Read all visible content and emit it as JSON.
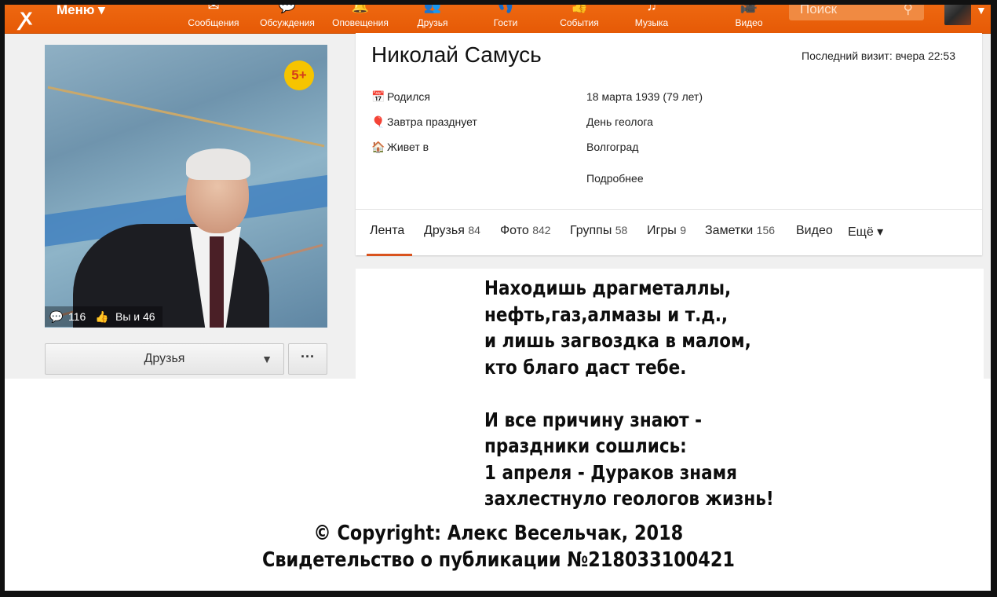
{
  "topbar": {
    "logo": "ок",
    "menu_label": "Меню ▾",
    "nav": [
      {
        "label": "Сообщения",
        "icon": "messages-icon",
        "glyph": "✉"
      },
      {
        "label": "Обсуждения",
        "icon": "discussions-icon",
        "glyph": "💬"
      },
      {
        "label": "Оповещения",
        "icon": "bell-icon",
        "glyph": "🔔"
      },
      {
        "label": "Друзья",
        "icon": "friends-icon",
        "glyph": "👥"
      },
      {
        "label": "Гости",
        "icon": "guests-icon",
        "glyph": "👣"
      },
      {
        "label": "События",
        "icon": "events-icon",
        "glyph": "👍"
      },
      {
        "label": "Музыка",
        "icon": "music-icon",
        "glyph": "♫"
      },
      {
        "label": "Видео",
        "icon": "video-icon",
        "glyph": "🎥"
      }
    ],
    "search_placeholder": "Поиск",
    "accent": "#ee6512"
  },
  "profile": {
    "name": "Николай Самусь",
    "last_visit": "Последний визит: вчера 22:53",
    "badge": "5+",
    "comments_count": "116",
    "likes_text": "Вы и 46",
    "info": [
      {
        "label": "Родился",
        "value": "18 марта 1939 (79 лет)",
        "icon": "calendar-icon"
      },
      {
        "label": "Завтра празднует",
        "value": "День геолога",
        "icon": "balloons-icon"
      },
      {
        "label": "Живет в",
        "value": "Волгоград",
        "icon": "house-icon"
      }
    ],
    "more_link": "Подробнее",
    "friends_button": "Друзья",
    "more_button": "···",
    "tabs": [
      {
        "label": "Лента",
        "count": ""
      },
      {
        "label": "Друзья",
        "count": "84"
      },
      {
        "label": "Фото",
        "count": "842"
      },
      {
        "label": "Группы",
        "count": "58"
      },
      {
        "label": "Игры",
        "count": "9"
      },
      {
        "label": "Заметки",
        "count": "156"
      },
      {
        "label": "Видео",
        "count": ""
      },
      {
        "label": "Ещё ▾",
        "count": ""
      }
    ]
  },
  "poem": {
    "lines": [
      "Находишь драгметаллы,",
      "нефть,газ,алмазы и т.д.,",
      "и лишь загвоздка в малом,",
      "кто благо даст тебе.",
      "",
      "И все причину знают -",
      "праздники сошлись:",
      "1 апреля - Дураков знамя",
      "захлестнуло геологов жизнь!"
    ],
    "copyright": "© Copyright: Алекс Весельчак, 2018",
    "certificate": "Свидетельство о публикации №218033100421"
  }
}
